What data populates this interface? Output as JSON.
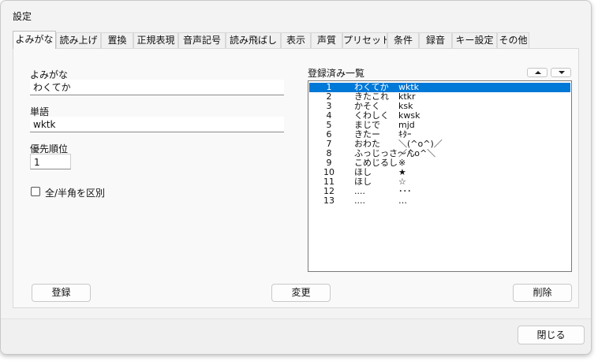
{
  "window": {
    "title": "設定"
  },
  "tabs": [
    {
      "label": "よみがな",
      "active": true
    },
    {
      "label": "読み上げ"
    },
    {
      "label": "置換"
    },
    {
      "label": "正規表現"
    },
    {
      "label": "音声記号"
    },
    {
      "label": "読み飛ばし"
    },
    {
      "label": "表示"
    },
    {
      "label": "声質"
    },
    {
      "label": "プリセット"
    },
    {
      "label": "条件"
    },
    {
      "label": "録音"
    },
    {
      "label": "キー設定"
    },
    {
      "label": "その他"
    }
  ],
  "form": {
    "yomigana_label": "よみがな",
    "yomigana_value": "わくてか",
    "word_label": "単語",
    "word_value": "wktk",
    "priority_label": "優先順位",
    "priority_value": "1",
    "width_checkbox_label": "全/半角を区別",
    "width_checkbox_checked": false
  },
  "list": {
    "label": "登録済み一覧",
    "selected_index": 0,
    "rows": [
      {
        "num": "1",
        "yomi": "わくてか",
        "word": "wktk"
      },
      {
        "num": "2",
        "yomi": "きたこれ",
        "word": "ktkr"
      },
      {
        "num": "3",
        "yomi": "かそく",
        "word": "ksk"
      },
      {
        "num": "4",
        "yomi": "くわしく",
        "word": "kwsk"
      },
      {
        "num": "5",
        "yomi": "まじで",
        "word": "mjd"
      },
      {
        "num": "6",
        "yomi": "きたー",
        "word": "ｷﾀｰ"
      },
      {
        "num": "7",
        "yomi": "おわた",
        "word": "＼(^o^)／"
      },
      {
        "num": "8",
        "yomi": "ふっじっさ～ん",
        "word": "／^o^＼"
      },
      {
        "num": "9",
        "yomi": "こめじるし",
        "word": "※"
      },
      {
        "num": "10",
        "yomi": "ほし",
        "word": "★"
      },
      {
        "num": "11",
        "yomi": "ほし",
        "word": "☆"
      },
      {
        "num": "12",
        "yomi": "....",
        "word": "･･･"
      },
      {
        "num": "13",
        "yomi": "....",
        "word": "…"
      }
    ]
  },
  "buttons": {
    "register": "登録",
    "change": "変更",
    "delete": "削除",
    "close": "閉じる"
  }
}
